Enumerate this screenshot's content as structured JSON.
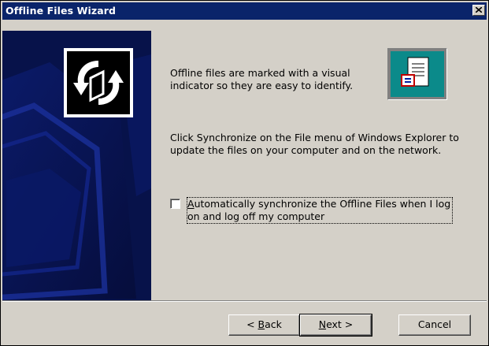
{
  "window": {
    "title": "Offline Files Wizard",
    "close_label": "×"
  },
  "banner": {
    "logo_icon": "offline-sync-arrows-icon",
    "background_color": "#07124a"
  },
  "content": {
    "paragraph1": "Offline files are marked with a visual indicator so they are easy to identify.",
    "paragraph2": "Click Synchronize on the File menu of Windows Explorer to update the files on your computer and on the network.",
    "preview_icon": "offline-document-icon",
    "checkbox": {
      "label_prefix": "A",
      "label_rest": "utomatically synchronize the Offline Files when I log on and log off my computer",
      "checked": false
    }
  },
  "buttons": {
    "back_prefix": "< ",
    "back_hotkey": "B",
    "back_rest": "ack",
    "next_hotkey": "N",
    "next_rest": "ext >",
    "cancel": "Cancel"
  },
  "colors": {
    "titlebar": "#0a246a",
    "dialog": "#d4d0c8",
    "icon_teal": "#0b8a8a"
  }
}
